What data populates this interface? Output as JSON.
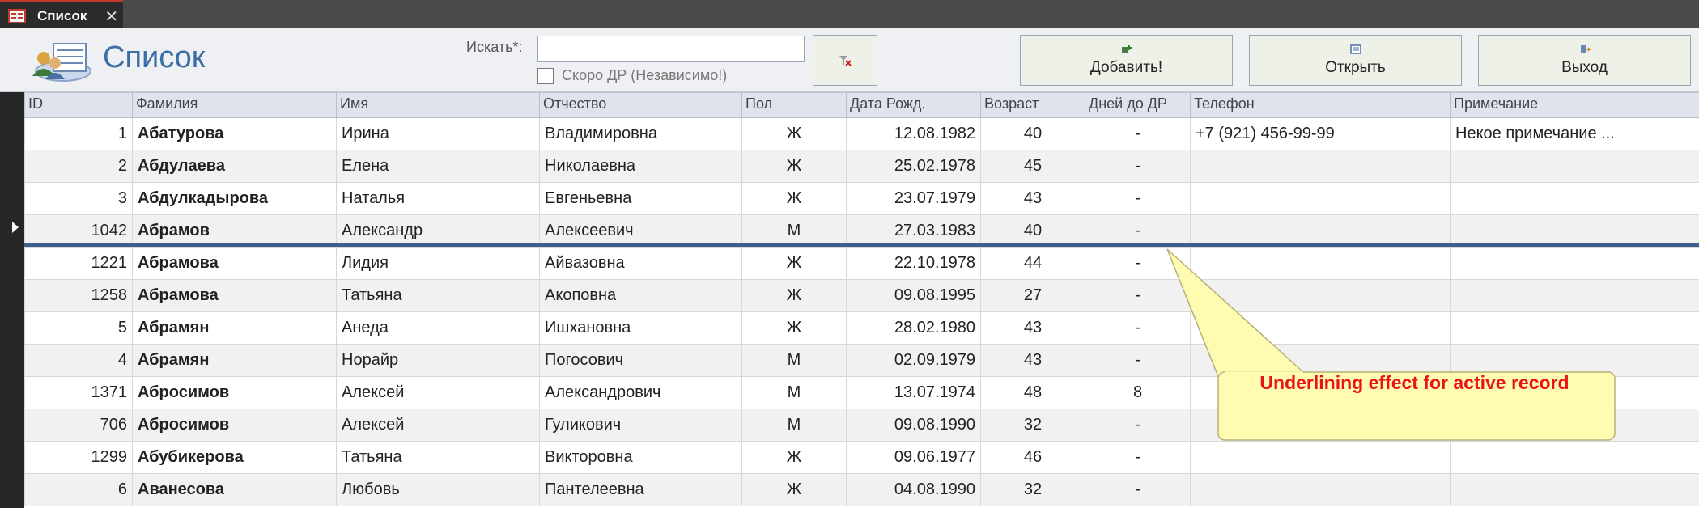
{
  "tab": {
    "label": "Список",
    "close": "✕"
  },
  "header": {
    "title": "Список",
    "search_label": "Искать*:",
    "search_value": "",
    "checkbox_label": "Скоро ДР (Независимо!)",
    "buttons": {
      "add": "Добавить!",
      "open": "Открыть",
      "exit": "Выход"
    }
  },
  "colors": {
    "accent": "#3c6ea6",
    "active_line": "#3e5f8e",
    "callout_fill": "#fffbb0",
    "callout_text": "#e8141c"
  },
  "icons": [
    "form-icon",
    "close-icon",
    "contacts-logo-icon",
    "clear-filter-icon",
    "add-icon",
    "open-icon",
    "exit-icon",
    "record-selector-arrow-icon"
  ],
  "table": {
    "columns": [
      "ID",
      "Фамилия",
      "Имя",
      "Отчество",
      "Пол",
      "Дата Рожд.",
      "Возраст",
      "Дней до ДР",
      "Телефон",
      "Примечание"
    ],
    "rows": [
      {
        "id": "1",
        "last": "Абатурова",
        "first": "Ирина",
        "middle": "Владимировна",
        "sex": "Ж",
        "dob": "12.08.1982",
        "age": "40",
        "days": "-",
        "phone": "+7 (921) 456-99-99",
        "note": "Некое примечание  ..."
      },
      {
        "id": "2",
        "last": "Абдулаева",
        "first": "Елена",
        "middle": "Николаевна",
        "sex": "Ж",
        "dob": "25.02.1978",
        "age": "45",
        "days": "-",
        "phone": "",
        "note": ""
      },
      {
        "id": "3",
        "last": "Абдулкадырова",
        "first": "Наталья",
        "middle": "Евгеньевна",
        "sex": "Ж",
        "dob": "23.07.1979",
        "age": "43",
        "days": "-",
        "phone": "",
        "note": ""
      },
      {
        "id": "1042",
        "last": "Абрамов",
        "first": "Александр",
        "middle": "Алексеевич",
        "sex": "М",
        "dob": "27.03.1983",
        "age": "40",
        "days": "-",
        "phone": "",
        "note": ""
      },
      {
        "id": "1221",
        "last": "Абрамова",
        "first": "Лидия",
        "middle": "Айвазовна",
        "sex": "Ж",
        "dob": "22.10.1978",
        "age": "44",
        "days": "-",
        "phone": "",
        "note": ""
      },
      {
        "id": "1258",
        "last": "Абрамова",
        "first": "Татьяна",
        "middle": "Акоповна",
        "sex": "Ж",
        "dob": "09.08.1995",
        "age": "27",
        "days": "-",
        "phone": "",
        "note": ""
      },
      {
        "id": "5",
        "last": "Абрамян",
        "first": "Анеда",
        "middle": "Ишхановна",
        "sex": "Ж",
        "dob": "28.02.1980",
        "age": "43",
        "days": "-",
        "phone": "",
        "note": ""
      },
      {
        "id": "4",
        "last": "Абрамян",
        "first": "Норайр",
        "middle": "Погосович",
        "sex": "М",
        "dob": "02.09.1979",
        "age": "43",
        "days": "-",
        "phone": "",
        "note": ""
      },
      {
        "id": "1371",
        "last": "Абросимов",
        "first": "Алексей",
        "middle": "Александрович",
        "sex": "М",
        "dob": "13.07.1974",
        "age": "48",
        "days": "8",
        "phone": "",
        "note": ""
      },
      {
        "id": "706",
        "last": "Абросимов",
        "first": "Алексей",
        "middle": "Гуликович",
        "sex": "М",
        "dob": "09.08.1990",
        "age": "32",
        "days": "-",
        "phone": "",
        "note": ""
      },
      {
        "id": "1299",
        "last": "Абубикерова",
        "first": "Татьяна",
        "middle": "Викторовна",
        "sex": "Ж",
        "dob": "09.06.1977",
        "age": "46",
        "days": "-",
        "phone": "",
        "note": ""
      },
      {
        "id": "6",
        "last": "Аванесова",
        "first": "Любовь",
        "middle": "Пантелеевна",
        "sex": "Ж",
        "dob": "04.08.1990",
        "age": "32",
        "days": "-",
        "phone": "",
        "note": ""
      }
    ]
  },
  "callout": {
    "text": "Underlining effect for active record"
  }
}
